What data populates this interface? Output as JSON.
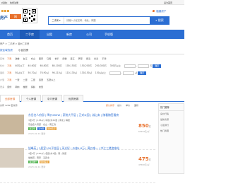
{
  "topbar": {
    "left_links": [
      "[切换]",
      "免费注册"
    ],
    "right_links": [
      "设为首页"
    ]
  },
  "brand": {
    "logo_main": "房产",
    "logo_badge": "网",
    "city": "福州"
  },
  "search": {
    "category": "二手房",
    "placeholder": "请输入小区名称、地址、商圈",
    "button": "搜索"
  },
  "location": {
    "label": "福建房产"
  },
  "nav": {
    "items": [
      "首页",
      "二手房",
      "出租",
      "新房",
      "公司",
      "手机版"
    ],
    "active_index": 1
  },
  "breadcrumb": "房产 > 二手房 > 福州二手房",
  "filter_tabs": [
    "按区域找房",
    "小区找房"
  ],
  "filters": {
    "region": {
      "label": "区域",
      "options": [
        "不限",
        "鼓楼",
        "台江",
        "仓山",
        "晋安",
        "马尾",
        "长乐",
        "闽侯",
        "连江",
        "罗源",
        "闽清",
        "永泰",
        "平潭"
      ]
    },
    "price": {
      "label": "售价",
      "options": [
        "不限",
        "40万以下",
        "40-60万",
        "60-80万",
        "80-100万",
        "100-150万",
        "150-200万",
        "200-300万",
        "300万以上"
      ],
      "unit": "万",
      "ok": "确定"
    },
    "area": {
      "label": "面积",
      "options": [
        "不限",
        "50㎡以下",
        "50-70㎡",
        "70-90㎡",
        "90-110㎡",
        "110-130㎡",
        "130-150㎡",
        "150㎡以上"
      ],
      "unit": "㎡",
      "ok": "确定"
    },
    "rooms": {
      "label": "户型",
      "options": [
        "不限",
        "一室",
        "二室",
        "三室",
        "四室",
        "五室以上"
      ]
    },
    "more": {
      "label": "更多",
      "options": [
        "装修",
        "朝向",
        "楼层",
        "房龄",
        "类型"
      ]
    }
  },
  "sort_tabs": [
    "全部房源",
    "个人房源",
    "中介房源",
    "优质房源"
  ],
  "sort_tabs_active": 0,
  "sortbar": {
    "text": "共有 1289 套房源",
    "options": [
      "默认排序",
      "总价",
      "单价",
      "面积"
    ]
  },
  "listings": [
    {
      "title": "东岳名人府邸 | 降价280W | 豪装大平层 | 正对公园 | 诚心卖 | 随看随签看房",
      "line1": "3室2厅 | 138㎡ | 中层/共32层 | 南北 | 精装",
      "line2": "东岳名人府邸 - 仓山 - 南江滨",
      "tags": [
        "满五年",
        "近地铁",
        "随时看房"
      ],
      "time": "2023-02-14 更新",
      "price": "850",
      "unit": "万",
      "price_note": "61594元/㎡"
    },
    {
      "title": "旭峰苑 | 3居室100平花园 | 采光好 | 价格4.8万 | 满五唯一 | 中江三楼变电站",
      "line1": "3室2厅 | 100㎡ | 低层/共7层 | 南 | 简装",
      "line2": "旭峰苑 - 晋安 - 五四北",
      "tags": [
        "满五唯一",
        "随时看房"
      ],
      "time": "2023-02-14 更新",
      "price": "475",
      "unit": "万",
      "price_note": "47500元/㎡"
    }
  ],
  "sidebar": {
    "title": "热门推荐",
    "items": [
      "房价行情",
      "最新房源",
      "小区排行",
      "热门商圈"
    ]
  },
  "colors": {
    "primary": "#2b6ed3",
    "accent": "#e8712d",
    "tag": "#5cb85c"
  }
}
